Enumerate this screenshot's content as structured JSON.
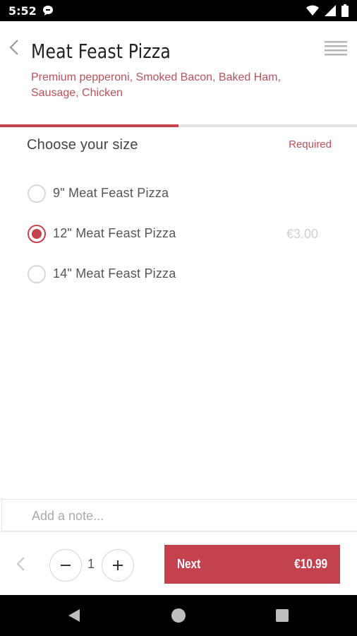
{
  "status_bar": {
    "time": "5:52",
    "icons": [
      "chat-notification-icon",
      "wifi-icon",
      "cellular-signal-icon",
      "battery-icon"
    ]
  },
  "header": {
    "title": "Meat Feast Pizza",
    "description": "Premium pepperoni, Smoked Bacon, Baked Ham, Sausage, Chicken",
    "progress_fraction": 0.5
  },
  "size_section": {
    "title": "Choose your size",
    "required_label": "Required",
    "options": [
      {
        "label": "9\" Meat Feast Pizza",
        "price": "",
        "selected": false
      },
      {
        "label": "12\" Meat Feast Pizza",
        "price": "€3.00",
        "selected": true
      },
      {
        "label": "14\" Meat Feast Pizza",
        "price": "",
        "selected": false
      }
    ]
  },
  "note": {
    "placeholder": "Add a note...",
    "value": ""
  },
  "footer": {
    "quantity": "1",
    "next_label": "Next",
    "total": "€10.99"
  },
  "colors": {
    "accent": "#c4424d",
    "subtitle": "#b8525a"
  }
}
